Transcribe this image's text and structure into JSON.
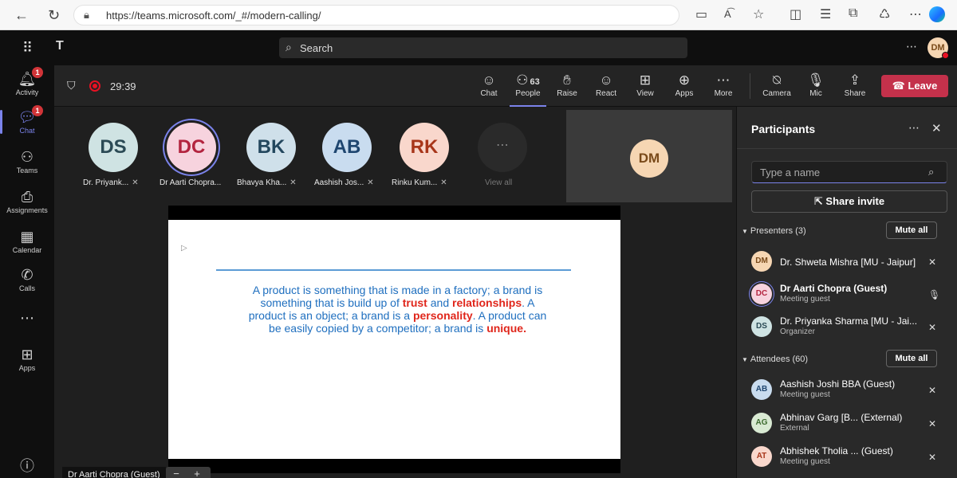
{
  "browser": {
    "url": "https://teams.microsoft.com/_#/modern-calling/"
  },
  "teams": {
    "search_placeholder": "Search",
    "user_initials": "DM"
  },
  "rail": {
    "items": [
      {
        "label": "Activity",
        "badge": "1"
      },
      {
        "label": "Chat",
        "badge": "1"
      },
      {
        "label": "Teams"
      },
      {
        "label": "Assignments"
      },
      {
        "label": "Calendar"
      },
      {
        "label": "Calls"
      },
      {
        "label": "Apps"
      },
      {
        "label": "Help"
      }
    ]
  },
  "meeting": {
    "timer": "29:39",
    "toolbar": {
      "chat": "Chat",
      "people": "People",
      "people_count": "63",
      "raise": "Raise",
      "react": "React",
      "view": "View",
      "apps": "Apps",
      "more": "More",
      "camera": "Camera",
      "mic": "Mic",
      "share": "Share",
      "leave": "Leave"
    },
    "gallery": [
      {
        "initials": "DS",
        "name": "Dr. Priyank...",
        "bg": "#cfe3e3",
        "fg": "#2b4a55"
      },
      {
        "initials": "DC",
        "name": "Dr Aarti Chopra...",
        "bg": "#f7d3de",
        "fg": "#b3243f"
      },
      {
        "initials": "BK",
        "name": "Bhavya Kha...",
        "bg": "#cfe0ea",
        "fg": "#23475e"
      },
      {
        "initials": "AB",
        "name": "Aashish Jos...",
        "bg": "#c9dcef",
        "fg": "#1f4670"
      },
      {
        "initials": "RK",
        "name": "Rinku Kum...",
        "bg": "#f9d7cc",
        "fg": "#a8361a"
      }
    ],
    "view_all": "View all",
    "self_initials": "DM",
    "presenter_tag": "Dr Aarti Chopra (Guest)"
  },
  "slide": {
    "part1": "A product is something that is made in a factory; a brand is something that is build up of ",
    "trust": "trust",
    "part2": " and ",
    "relationships": "relationships",
    "part3": ".  A product is an object; a brand is a ",
    "personality": "personality",
    "part4": ".  A product can be easily copied by a competitor; a brand is ",
    "unique": "unique."
  },
  "panel": {
    "title": "Participants",
    "search_placeholder": "Type a name",
    "share_invite": "Share invite",
    "presenters_label": "Presenters (3)",
    "attendees_label": "Attendees (60)",
    "mute_all": "Mute all",
    "presenters": [
      {
        "initials": "DM",
        "name": "Dr. Shweta Mishra [MU - Jaipur]",
        "sub": "",
        "bg": "#f6d6b3",
        "fg": "#7a4a1a",
        "mic": "muted"
      },
      {
        "initials": "DC",
        "name": "Dr Aarti Chopra (Guest)",
        "sub": "Meeting guest",
        "bg": "#f7d3de",
        "fg": "#b3243f",
        "mic": "on"
      },
      {
        "initials": "DS",
        "name": "Dr. Priyanka Sharma [MU - Jai...",
        "sub": "Organizer",
        "bg": "#cfe3e3",
        "fg": "#2b4a55",
        "mic": "muted"
      }
    ],
    "attendees": [
      {
        "initials": "AB",
        "name": "Aashish Joshi BBA (Guest)",
        "sub": "Meeting guest",
        "bg": "#c9dcef",
        "fg": "#1f4670",
        "mic": "muted"
      },
      {
        "initials": "AG",
        "name": "Abhinav Garg [B...  (External)",
        "sub": "External",
        "bg": "#d9ead3",
        "fg": "#3d6b2f",
        "mic": "muted"
      },
      {
        "initials": "AT",
        "name": "Abhishek Tholia ...  (Guest)",
        "sub": "Meeting guest",
        "bg": "#f9d7cc",
        "fg": "#a8361a",
        "mic": "muted"
      }
    ]
  }
}
